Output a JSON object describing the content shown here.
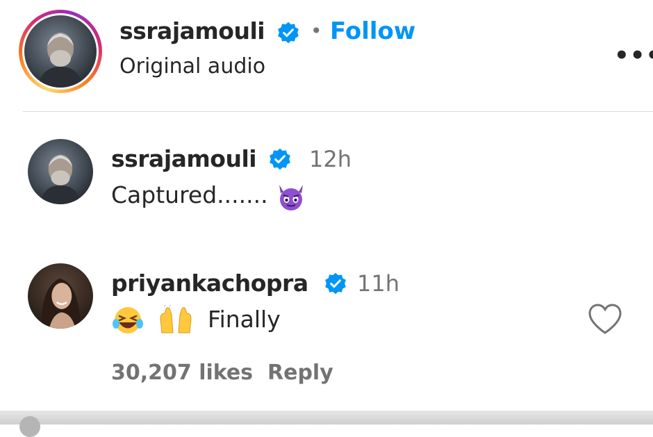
{
  "header": {
    "username": "ssrajamouli",
    "separator": "•",
    "follow_label": "Follow",
    "subtitle": "Original audio",
    "more_label": "•••"
  },
  "comments": [
    {
      "username": "ssrajamouli",
      "time": "12h",
      "text": "Captured.......",
      "emoji": [
        "smiling-imp-emoji"
      ]
    },
    {
      "username": "priyankachopra",
      "time": "11h",
      "text": "Finally",
      "emoji": [
        "rolling-laughing-emoji",
        "raised-hands-emoji"
      ]
    }
  ],
  "footer": {
    "likes": "30,207 likes",
    "reply_label": "Reply"
  },
  "colors": {
    "accent": "#0095f6",
    "verified": "#0095f6",
    "muted": "#737373",
    "text": "#262626"
  }
}
